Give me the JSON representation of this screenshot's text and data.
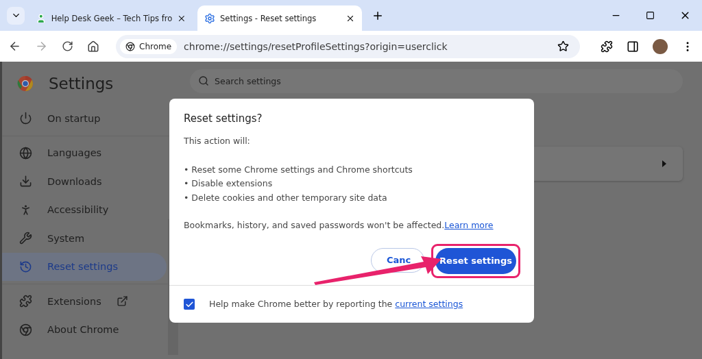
{
  "tabs": [
    {
      "title": "Help Desk Geek – Tech Tips fro",
      "selected": false
    },
    {
      "title": "Settings - Reset settings",
      "selected": true
    }
  ],
  "toolbar": {
    "site_chip": "Chrome",
    "url": "chrome://settings/resetProfileSettings?origin=userclick"
  },
  "settings": {
    "title": "Settings",
    "search": {
      "placeholder": "Search settings"
    },
    "sidebar": [
      [
        {
          "label": "On startup",
          "selected": false
        }
      ],
      [
        {
          "label": "Languages",
          "selected": false
        },
        {
          "label": "Downloads",
          "selected": false
        },
        {
          "label": "Accessibility",
          "selected": false
        },
        {
          "label": "System",
          "selected": false
        },
        {
          "label": "Reset settings",
          "selected": true
        }
      ],
      [
        {
          "label": "Extensions",
          "selected": false,
          "external": true
        },
        {
          "label": "About Chrome",
          "selected": false
        }
      ]
    ]
  },
  "dialog": {
    "title": "Reset settings?",
    "intro": "This action will:",
    "bullets": [
      "• Reset some Chrome settings and Chrome shortcuts",
      "• Disable extensions",
      "• Delete cookies and other temporary site data"
    ],
    "note": "Bookmarks, history, and saved passwords won't be affected.",
    "note_link": "Learn more",
    "cancel": "Canc",
    "confirm": "Reset settings",
    "confirm_highlighted": true,
    "report": {
      "checked": true,
      "text": "Help make Chrome better by reporting the ",
      "link": "current settings"
    }
  }
}
